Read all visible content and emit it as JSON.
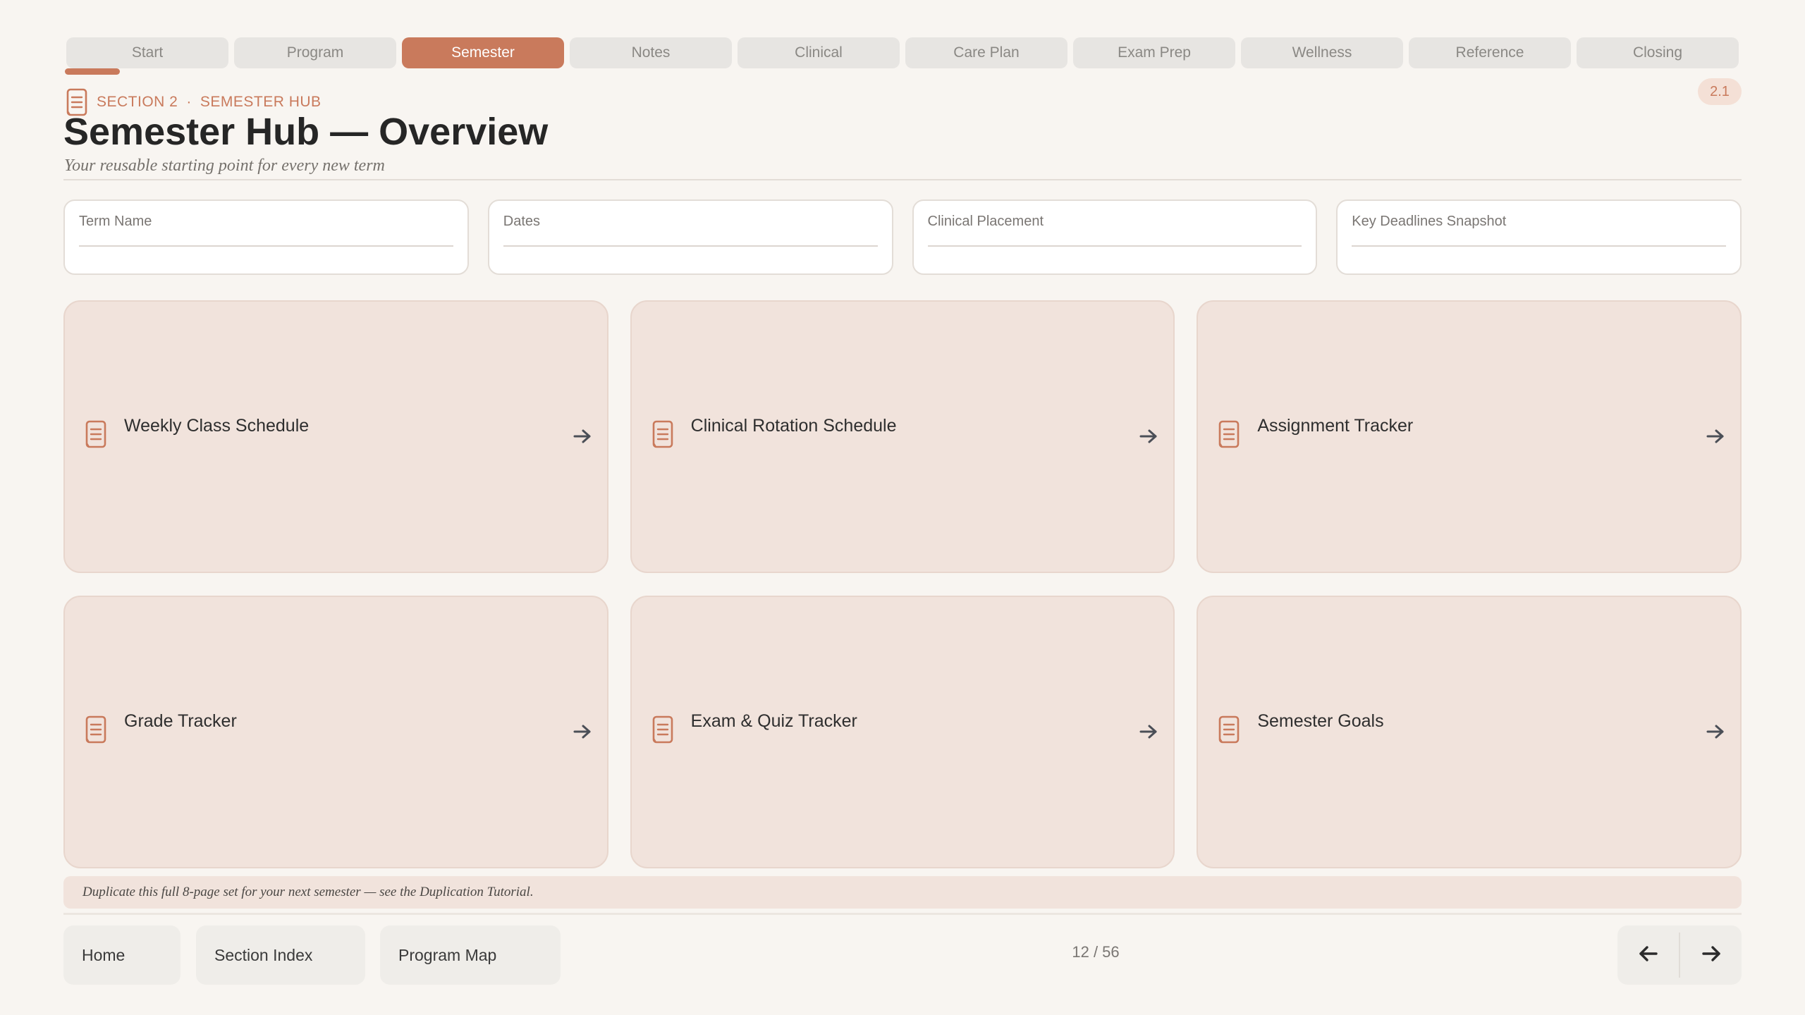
{
  "tabs": [
    {
      "label": "Start"
    },
    {
      "label": "Program"
    },
    {
      "label": "Semester",
      "active": true
    },
    {
      "label": "Notes"
    },
    {
      "label": "Clinical"
    },
    {
      "label": "Care Plan"
    },
    {
      "label": "Exam Prep"
    },
    {
      "label": "Wellness"
    },
    {
      "label": "Reference"
    },
    {
      "label": "Closing"
    }
  ],
  "header": {
    "section": "SECTION 2",
    "separator": "·",
    "section_name": "SEMESTER HUB",
    "page_badge": "2.1",
    "title": "Semester Hub — Overview",
    "subtitle": "Your reusable starting point for every new term"
  },
  "fields": [
    {
      "label": "Term Name",
      "value": ""
    },
    {
      "label": "Dates",
      "value": ""
    },
    {
      "label": "Clinical Placement",
      "value": ""
    },
    {
      "label": "Key Deadlines Snapshot",
      "value": ""
    }
  ],
  "cards": [
    {
      "title": "Weekly Class Schedule",
      "icon": "document-icon"
    },
    {
      "title": "Clinical Rotation Schedule",
      "icon": "document-icon"
    },
    {
      "title": "Assignment Tracker",
      "icon": "document-icon"
    },
    {
      "title": "Grade Tracker",
      "icon": "document-icon"
    },
    {
      "title": "Exam & Quiz Tracker",
      "icon": "document-icon"
    },
    {
      "title": "Semester Goals",
      "icon": "document-icon"
    }
  ],
  "note": "Duplicate this full 8-page set for your next semester — see the Duplication Tutorial.",
  "footer": {
    "home": "Home",
    "section_index": "Section Index",
    "program_map": "Program Map",
    "pager": "12 / 56"
  },
  "colors": {
    "accent": "#c97a5c",
    "card_bg": "#f1e3dc",
    "page_bg": "#f8f5f1",
    "tab_bg": "#e7e5e2"
  }
}
